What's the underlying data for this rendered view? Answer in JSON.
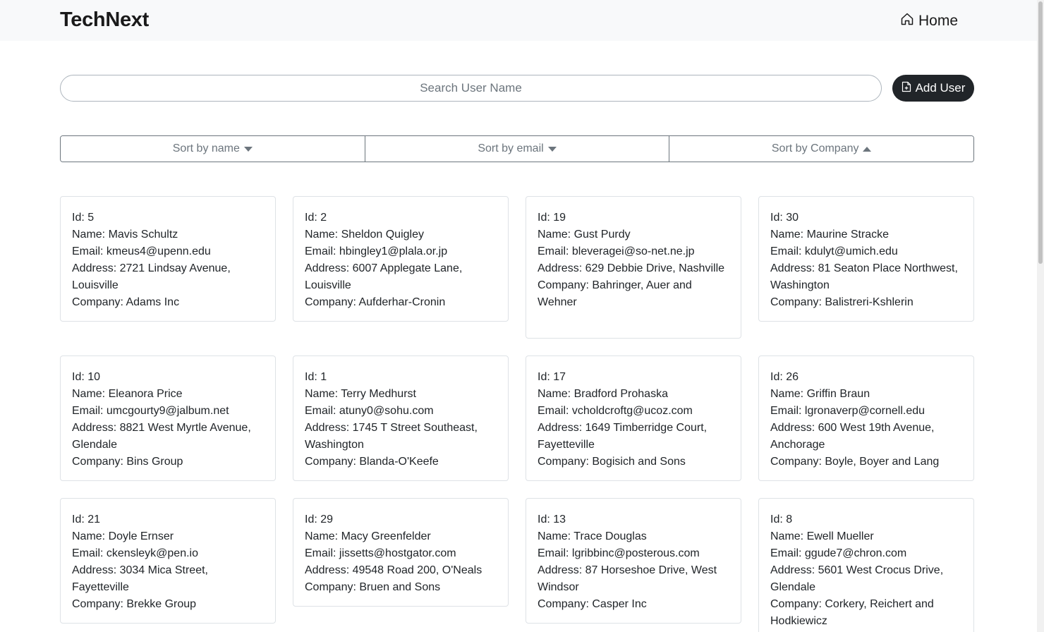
{
  "navbar": {
    "brand": "TechNext",
    "home_label": "Home"
  },
  "search": {
    "placeholder": "Search User Name",
    "value": ""
  },
  "add_user_label": "Add User",
  "sort": [
    {
      "label": "Sort by name",
      "direction": "down"
    },
    {
      "label": "Sort by email",
      "direction": "down"
    },
    {
      "label": "Sort by Company",
      "direction": "up"
    }
  ],
  "users": [
    {
      "id": "Id: 5",
      "name": "Name: Mavis Schultz",
      "email": "Email: kmeus4@upenn.edu",
      "address": "Address: 2721 Lindsay Avenue, Louisville",
      "company": "Company: Adams Inc"
    },
    {
      "id": "Id: 2",
      "name": "Name: Sheldon Quigley",
      "email": "Email: hbingley1@plala.or.jp",
      "address": "Address: 6007 Applegate Lane, Louisville",
      "company": "Company: Aufderhar-Cronin"
    },
    {
      "id": "Id: 19",
      "name": "Name: Gust Purdy",
      "email": "Email: bleveragei@so-net.ne.jp",
      "address": "Address: 629 Debbie Drive, Nashville",
      "company": "Company: Bahringer, Auer and Wehner"
    },
    {
      "id": "Id: 30",
      "name": "Name: Maurine Stracke",
      "email": "Email: kdulyt@umich.edu",
      "address": "Address: 81 Seaton Place Northwest, Washington",
      "company": "Company: Balistreri-Kshlerin"
    },
    {
      "id": "Id: 10",
      "name": "Name: Eleanora Price",
      "email": "Email: umcgourty9@jalbum.net",
      "address": "Address: 8821 West Myrtle Avenue, Glendale",
      "company": "Company: Bins Group"
    },
    {
      "id": "Id: 1",
      "name": "Name: Terry Medhurst",
      "email": "Email: atuny0@sohu.com",
      "address": "Address: 1745 T Street Southeast, Washington",
      "company": "Company: Blanda-O'Keefe"
    },
    {
      "id": "Id: 17",
      "name": "Name: Bradford Prohaska",
      "email": "Email: vcholdcroftg@ucoz.com",
      "address": "Address: 1649 Timberridge Court, Fayetteville",
      "company": "Company: Bogisich and Sons"
    },
    {
      "id": "Id: 26",
      "name": "Name: Griffin Braun",
      "email": "Email: lgronaverp@cornell.edu",
      "address": "Address: 600 West 19th Avenue, Anchorage",
      "company": "Company: Boyle, Boyer and Lang"
    },
    {
      "id": "Id: 21",
      "name": "Name: Doyle Ernser",
      "email": "Email: ckensleyk@pen.io",
      "address": "Address: 3034 Mica Street, Fayetteville",
      "company": "Company: Brekke Group"
    },
    {
      "id": "Id: 29",
      "name": "Name: Macy Greenfelder",
      "email": "Email: jissetts@hostgator.com",
      "address": "Address: 49548 Road 200, O'Neals",
      "company": "Company: Bruen and Sons"
    },
    {
      "id": "Id: 13",
      "name": "Name: Trace Douglas",
      "email": "Email: lgribbinc@posterous.com",
      "address": "Address: 87 Horseshoe Drive, West Windsor",
      "company": "Company: Casper Inc"
    },
    {
      "id": "Id: 8",
      "name": "Name: Ewell Mueller",
      "email": "Email: ggude7@chron.com",
      "address": "Address: 5601 West Crocus Drive, Glendale",
      "company": "Company: Corkery, Reichert and Hodkiewicz"
    }
  ]
}
